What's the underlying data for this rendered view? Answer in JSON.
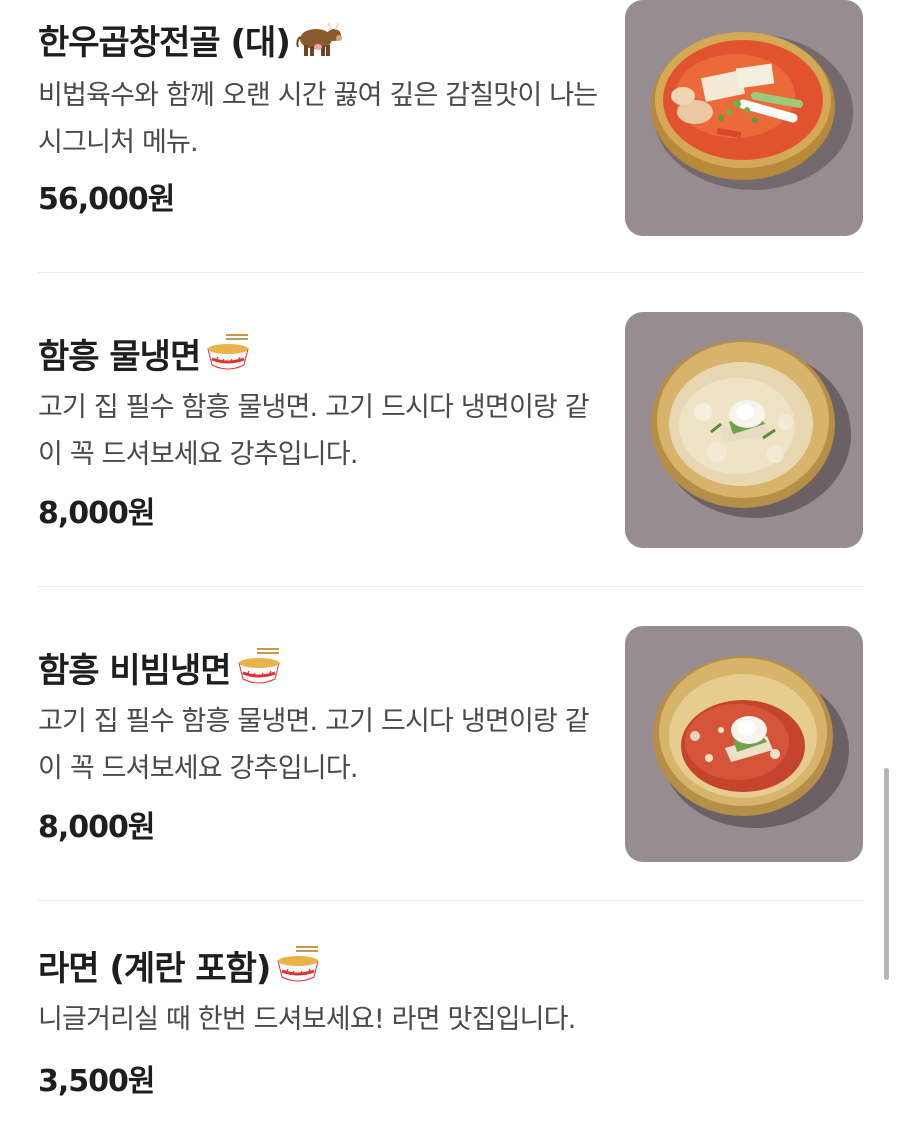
{
  "menu": {
    "items": [
      {
        "name": "한우곱창전골 (대)",
        "emoji": "cow-emoji",
        "description": "비법육수와 함께 오랜 시간 끓여 깊은 감칠맛이 나는 시그니처 메뉴.",
        "price": "56,000원",
        "dish": "gopchang-jeongol"
      },
      {
        "name": "함흥 물냉면",
        "emoji": "noodle-bowl-emoji",
        "description": "고기 집 필수 함흥 물냉면. 고기 드시다 냉면이랑 같이 꼭 드셔보세요 강추입니다.",
        "price": "8,000원",
        "dish": "mul-naengmyeon"
      },
      {
        "name": "함흥 비빔냉면",
        "emoji": "noodle-bowl-emoji",
        "description": "고기 집 필수 함흥 물냉면. 고기 드시다 냉면이랑 같이 꼭 드셔보세요 강추입니다.",
        "price": "8,000원",
        "dish": "bibim-naengmyeon"
      },
      {
        "name": "라면 (계란 포함)",
        "emoji": "noodle-bowl-emoji",
        "description": "니글거리실 때 한번 드셔보세요! 라면 맛집입니다.",
        "price": "3,500원",
        "dish": "none"
      }
    ]
  },
  "colors": {
    "text_primary": "#1e1e1e",
    "text_secondary": "#4a4a4a",
    "divider": "#ececec",
    "photo_background": "#8f8488",
    "scrollbar": "#b5b5b5"
  }
}
